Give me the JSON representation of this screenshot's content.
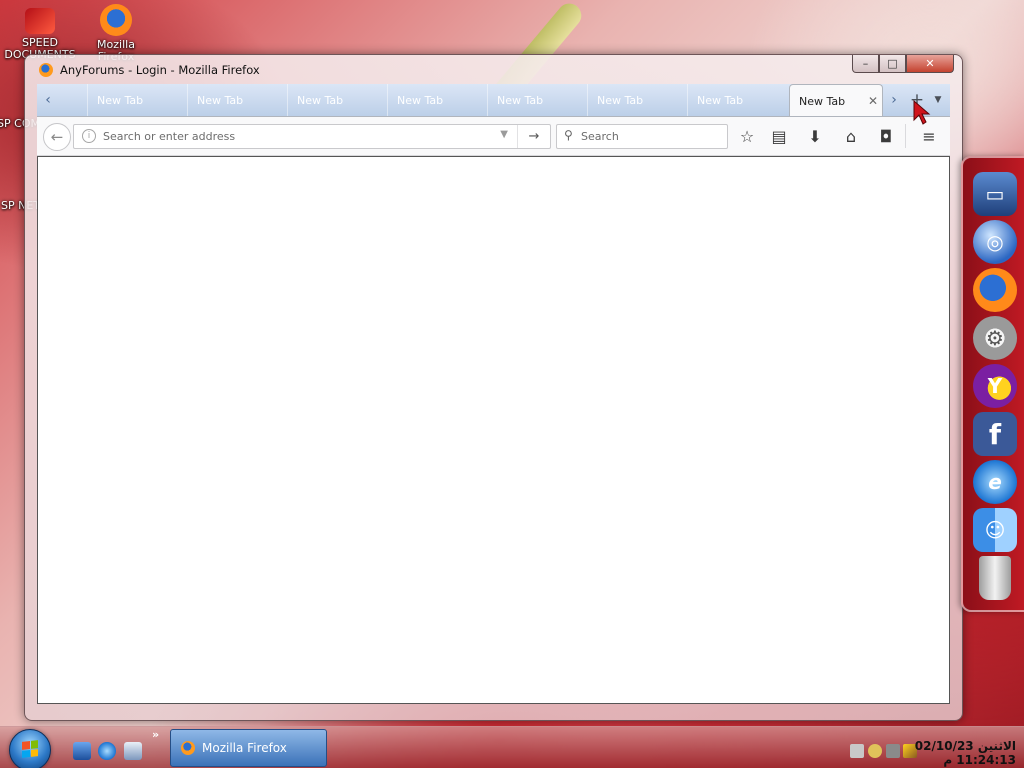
{
  "desktop": {
    "icons": [
      {
        "label": "SPEED DOCUMENTS",
        "icon": "folder-icon"
      },
      {
        "label": "Mozilla Firefox",
        "icon": "firefox-icon"
      }
    ],
    "partial_labels": [
      "SP COM",
      "SP NET"
    ]
  },
  "window": {
    "title": "AnyForums - Login - Mozilla Firefox",
    "controls": {
      "minimize": "–",
      "maximize": "□",
      "close": "✕"
    }
  },
  "tabs": [
    {
      "label": "New Tab",
      "active": false
    },
    {
      "label": "New Tab",
      "active": false
    },
    {
      "label": "New Tab",
      "active": false
    },
    {
      "label": "New Tab",
      "active": false
    },
    {
      "label": "New Tab",
      "active": false
    },
    {
      "label": "New Tab",
      "active": false
    },
    {
      "label": "New Tab",
      "active": false
    },
    {
      "label": "New Tab",
      "active": true
    }
  ],
  "navbar": {
    "url_placeholder": "Search or enter address",
    "url_value": "",
    "search_placeholder": "Search"
  },
  "dock": {
    "items": [
      "computer-icon",
      "globe-icon",
      "firefox-icon",
      "settings-icon",
      "yahoo-messenger-icon",
      "facebook-icon",
      "internet-explorer-icon",
      "finder-icon",
      "trash-icon"
    ]
  },
  "taskbar": {
    "task_label": "Mozilla Firefox",
    "chevron": "»",
    "clock_date": "الاثنين 02/10/23",
    "clock_time": "11:24:13 م"
  },
  "colors": {
    "tab_strip": "#c7d8ef",
    "toolbar": "#f9f9fa",
    "taskbar_button": "#3b72b8",
    "dock": "#b0151f"
  }
}
